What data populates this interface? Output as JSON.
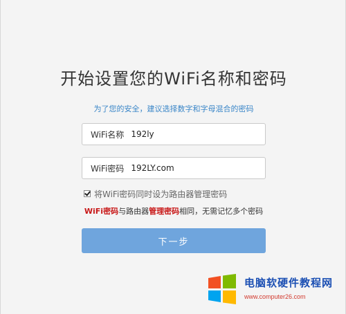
{
  "title": "开始设置您的WiFi名称和密码",
  "subtitle": "为了您的安全，建议选择数字和字母混合的密码",
  "fields": [
    {
      "label": "WiFi名称",
      "value": "192ly"
    },
    {
      "label": "WiFi密码",
      "value": "192LY.com"
    }
  ],
  "checkbox": {
    "label": "将WiFi密码同时设为路由器管理密码",
    "checked": true
  },
  "hint": {
    "part1": "WiFi密码",
    "part2": "与路由器",
    "part3": "管理密码",
    "part4": "相同，无需记忆多个密码"
  },
  "next_button": "下一步",
  "watermark": {
    "site_name": "电脑软硬件教程网",
    "url": "www.computer26.com",
    "logo_icon": "windows-logo-icon"
  },
  "colors": {
    "accent_blue": "#3a86c8",
    "button_blue": "#6fa5dd",
    "hint_red": "#c81818"
  }
}
